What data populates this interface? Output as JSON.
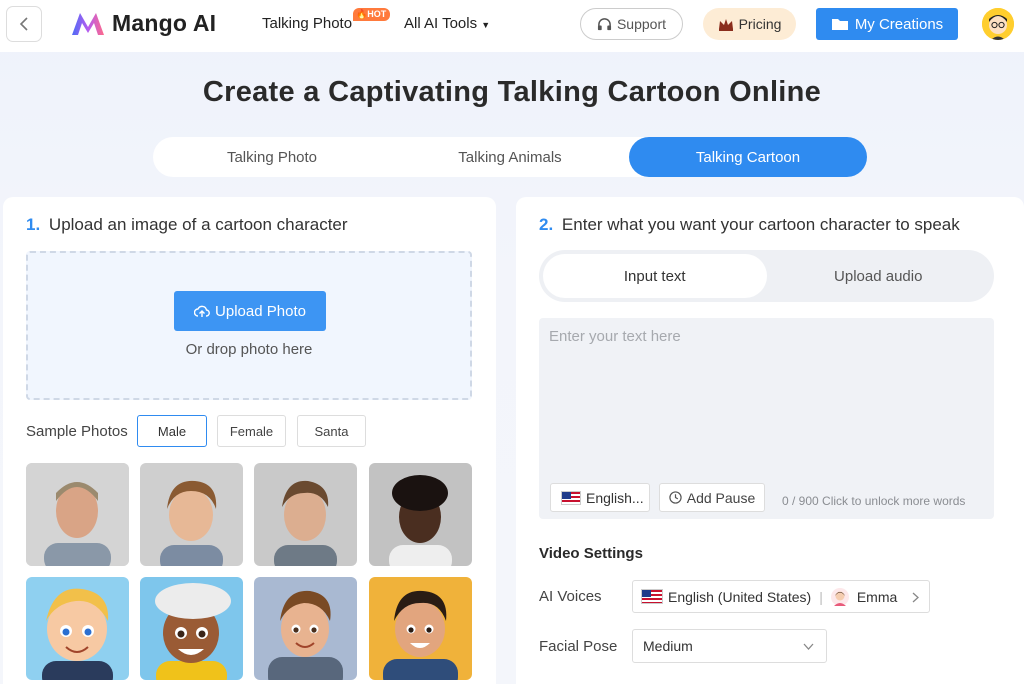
{
  "header": {
    "logo_text": "Mango AI",
    "nav": {
      "talking_photo": "Talking Photo",
      "hot_badge": "HOT",
      "ai_tools": "All AI Tools"
    },
    "support": "Support",
    "pricing": "Pricing",
    "my_creations": "My Creations"
  },
  "page": {
    "title": "Create a Captivating Talking Cartoon Online"
  },
  "tabs": [
    {
      "label": "Talking Photo",
      "active": false
    },
    {
      "label": "Talking Animals",
      "active": false
    },
    {
      "label": "Talking Cartoon",
      "active": true
    }
  ],
  "step1": {
    "num": "1.",
    "title": "Upload an image of a cartoon character",
    "upload_button": "Upload Photo",
    "drop_hint": "Or drop photo here",
    "sample_label": "Sample Photos",
    "chips": [
      "Male",
      "Female",
      "Santa"
    ],
    "active_chip": "Male"
  },
  "step2": {
    "num": "2.",
    "title": "Enter what you want your cartoon character to speak",
    "modes": [
      "Input text",
      "Upload audio"
    ],
    "active_mode": "Input text",
    "text_placeholder": "Enter your text here",
    "lang_button": "English...",
    "pause_button": "Add Pause",
    "counter": "0 / 900",
    "unlock_text": "Click to unlock more words"
  },
  "video_settings": {
    "title": "Video Settings",
    "ai_voices_label": "AI Voices",
    "voice_language": "English (United States)",
    "voice_name": "Emma",
    "facial_pose_label": "Facial Pose",
    "facial_pose_value": "Medium"
  },
  "colors": {
    "accent": "#2f8bf0",
    "pricing_bg": "#fdecd5",
    "hot": "#ff7a3c"
  },
  "icons": [
    "back-chevron-icon",
    "mango-logo-icon",
    "dropdown-caret-icon",
    "headset-icon",
    "crown-icon",
    "folder-icon",
    "cloud-upload-icon",
    "us-flag-icon",
    "clock-icon",
    "chevron-right-icon",
    "chevron-down-icon"
  ]
}
